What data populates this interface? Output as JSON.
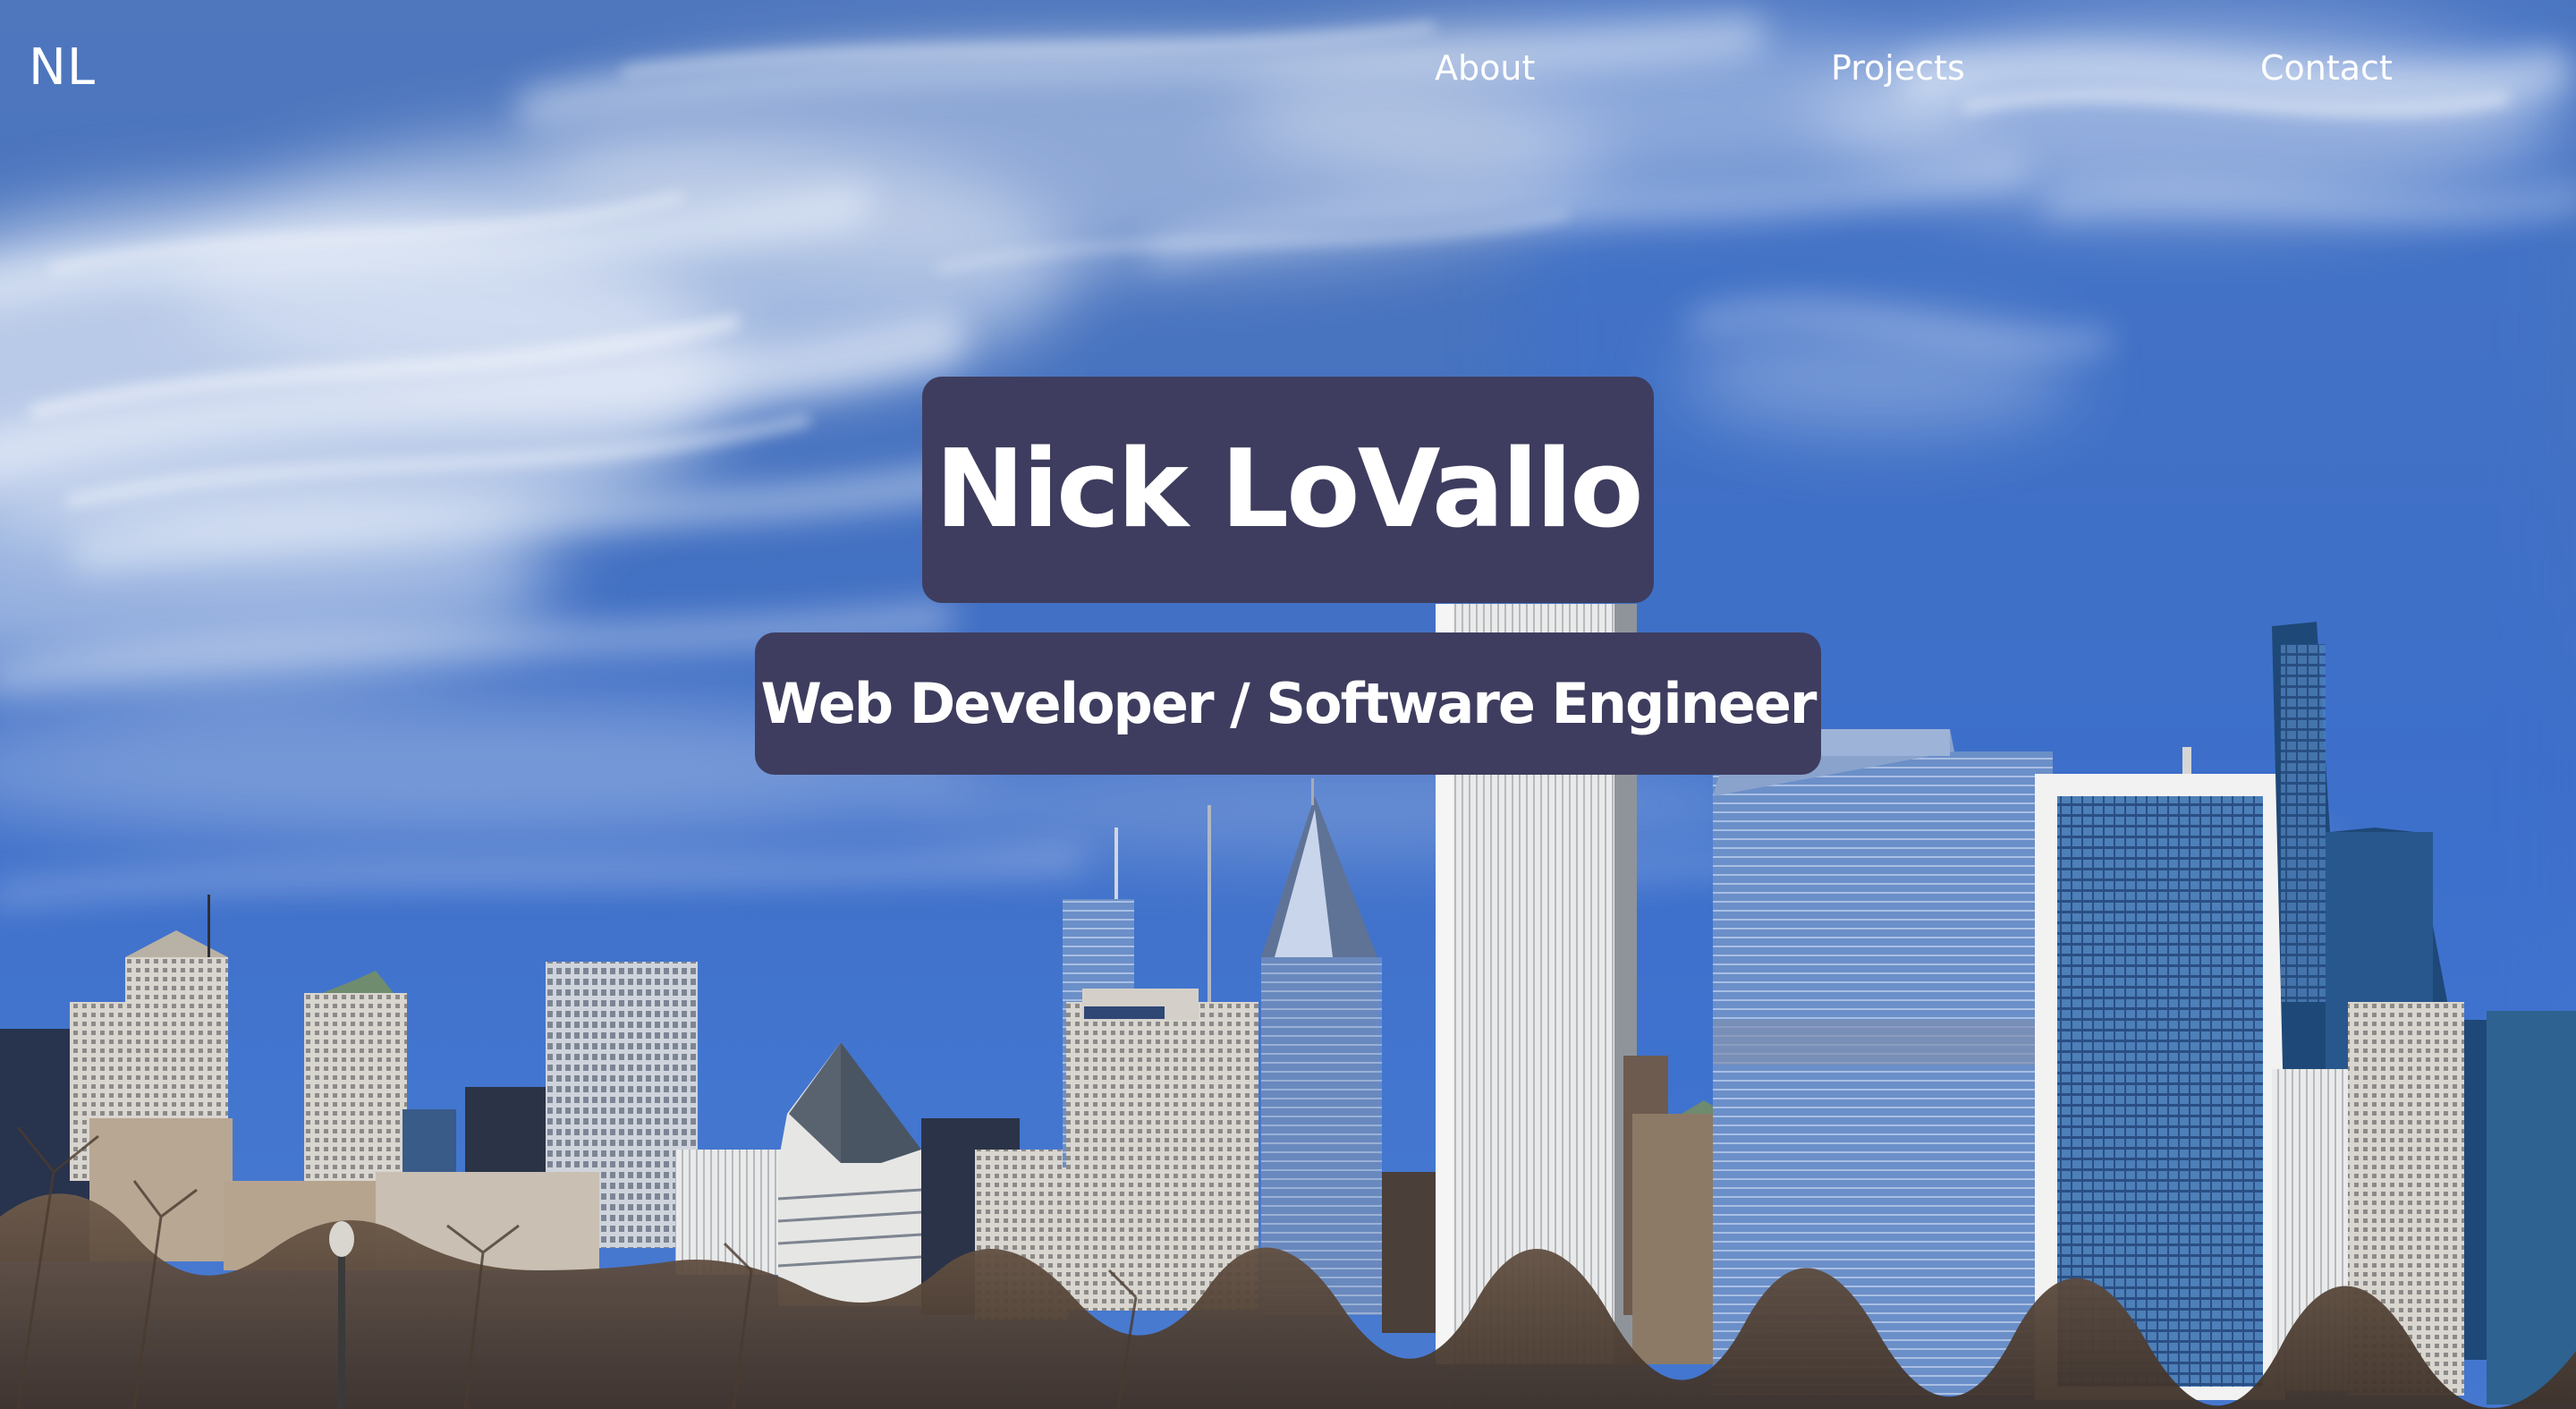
{
  "nav": {
    "logo": "NL",
    "links": [
      {
        "label": "About"
      },
      {
        "label": "Projects"
      },
      {
        "label": "Contact"
      }
    ]
  },
  "hero": {
    "title": "Nick LoVallo",
    "subtitle": "Web Developer / Software Engineer",
    "background": "city-skyline-photo",
    "title_box_color": "#3e3d5f",
    "text_color": "#ffffff"
  }
}
